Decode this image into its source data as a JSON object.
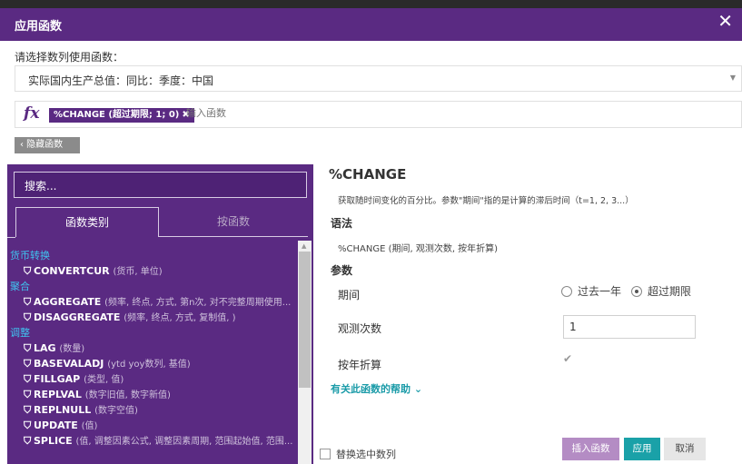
{
  "dialog": {
    "title": "应用函数",
    "close": "✕"
  },
  "series_select": {
    "label": "请选择数列使用函数：",
    "value": "实际国内生产总值：同比：季度：中国"
  },
  "formula": {
    "fx": "fx",
    "tag": "%CHANGE (超过期限; 1; 0)",
    "tag_remove": "✖",
    "placeholder": "输入函数"
  },
  "hide_button": "‹ 隐藏函数",
  "left_panel": {
    "search_placeholder": "搜索...",
    "tabs": [
      "函数类别",
      "按函数"
    ],
    "tree": [
      {
        "type": "cat",
        "label": "货币转换"
      },
      {
        "type": "fn",
        "name": "CONVERTCUR",
        "params": "(货币, 单位)"
      },
      {
        "type": "cat",
        "label": "聚合"
      },
      {
        "type": "fn",
        "name": "AGGREGATE",
        "params": "(频率, 终点, 方式, 第n次, 对不完整周期使用..."
      },
      {
        "type": "fn",
        "name": "DISAGGREGATE",
        "params": "(频率, 终点, 方式, 复制值, )"
      },
      {
        "type": "cat",
        "label": "调整"
      },
      {
        "type": "fn",
        "name": "LAG",
        "params": "(数量)"
      },
      {
        "type": "fn",
        "name": "BASEVALADJ",
        "params": "(ytd yoy数列, 基值)"
      },
      {
        "type": "fn",
        "name": "FILLGAP",
        "params": "(类型, 值)"
      },
      {
        "type": "fn",
        "name": "REPLVAL",
        "params": "(数字旧值, 数字新值)"
      },
      {
        "type": "fn",
        "name": "REPLNULL",
        "params": "(数字空值)"
      },
      {
        "type": "fn",
        "name": "UPDATE",
        "params": "(值)"
      },
      {
        "type": "fn",
        "name": "SPLICE",
        "params": "(值, 调整因素公式, 调整因素周期, 范围起始值, 范围..."
      }
    ]
  },
  "right_panel": {
    "function_name": "%CHANGE",
    "description": "获取随时间变化的百分比。参数\"期间\"指的是计算的滞后时间（t=1, 2, 3...）",
    "syntax_heading": "语法",
    "syntax": "%CHANGE (期间, 观测次数, 按年折算)",
    "params_heading": "参数",
    "period_label": "期间",
    "period_options": [
      "过去一年",
      "超过期限"
    ],
    "period_selected": 1,
    "obs_label": "观测次数",
    "obs_value": "1",
    "annualize_label": "按年折算",
    "annualize_checked": true,
    "help_link": "有关此函数的帮助 ⌄"
  },
  "footer": {
    "replace_label": "替换选中数列",
    "insert": "插入函数",
    "apply": "应用",
    "cancel": "取消"
  },
  "colors": {
    "purple": "#5a2a82",
    "teal": "#1aa1a8",
    "category": "#3fc4f0"
  }
}
